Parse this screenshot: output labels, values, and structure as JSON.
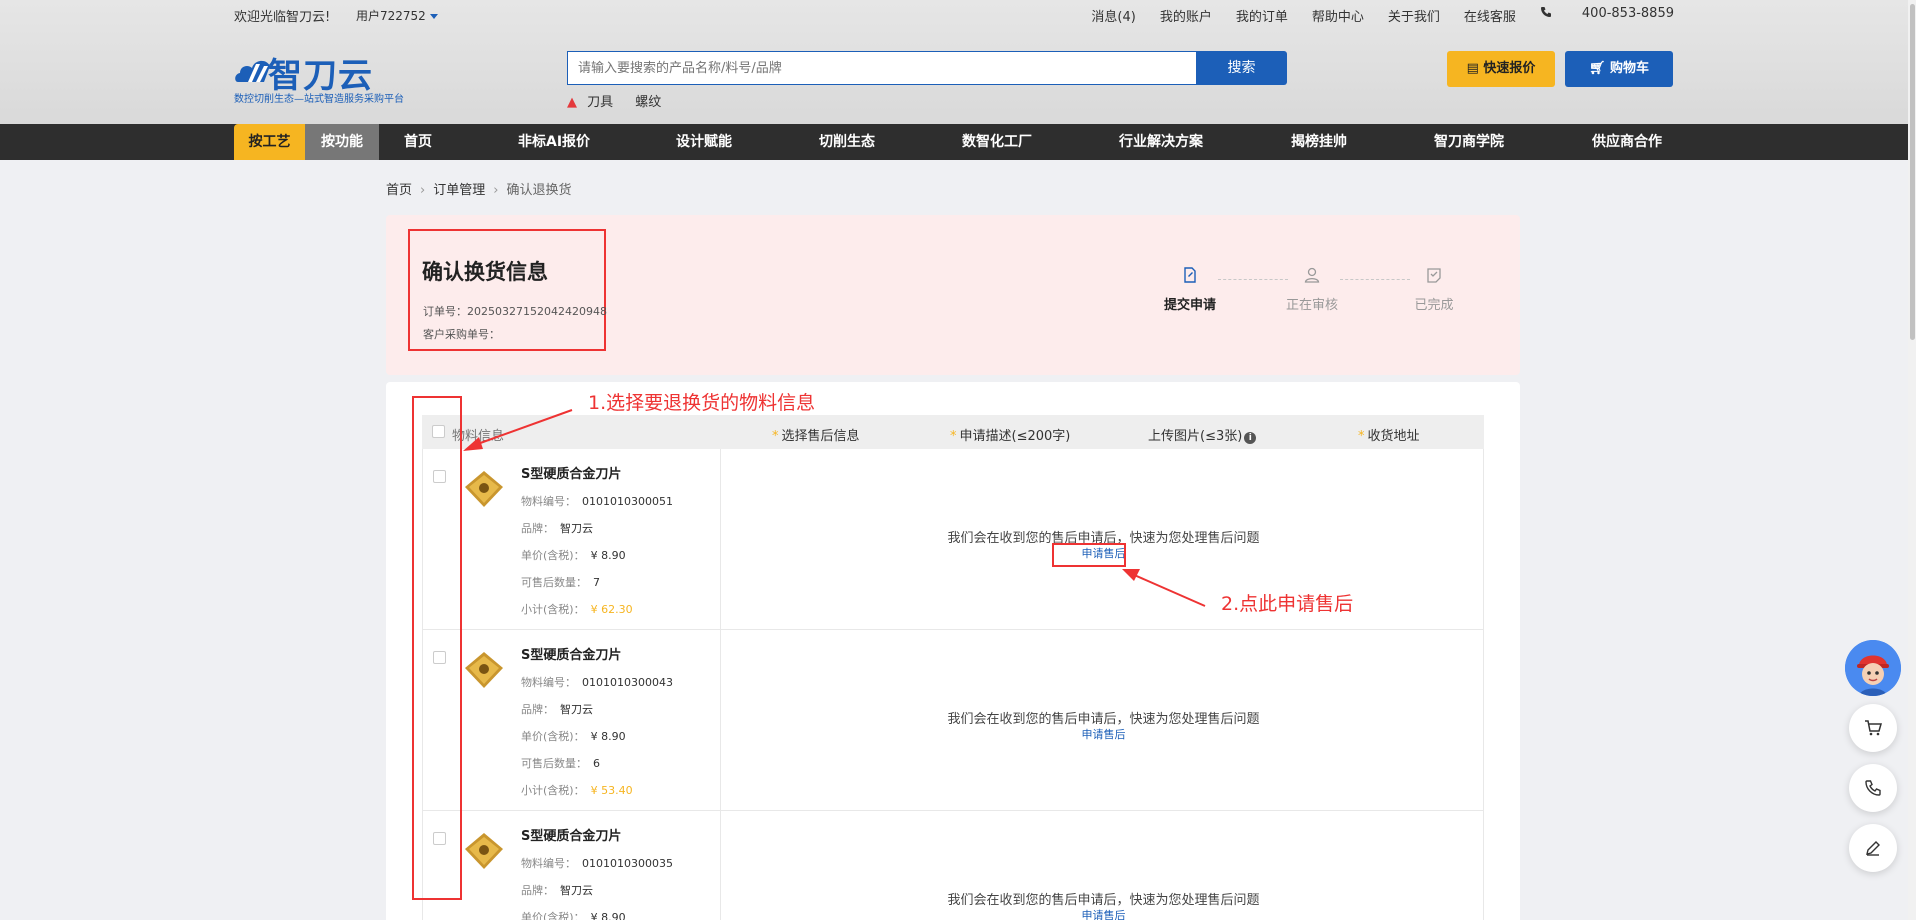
{
  "topbar": {
    "welcome": "欢迎光临智刀云!",
    "user": "用户722752",
    "links": [
      "消息(4)",
      "我的账户",
      "我的订单",
      "帮助中心",
      "关于我们",
      "在线客服"
    ],
    "phone": "400-853-8859"
  },
  "logo": {
    "name": "智刀云",
    "slogan": "数控切削生态—站式智造服务采购平台"
  },
  "search": {
    "placeholder": "请输入要搜索的产品名称/料号/品牌",
    "button": "搜索",
    "hot": [
      "刀具",
      "螺纹"
    ]
  },
  "header_buttons": {
    "quote": "快速报价",
    "cart": "购物车"
  },
  "nav": {
    "tab_process": "按工艺",
    "tab_function": "按功能",
    "items": [
      "首页",
      "非标AI报价",
      "设计赋能",
      "切削生态",
      "数智化工厂",
      "行业解决方案",
      "揭榜挂帅",
      "智刀商学院",
      "供应商合作"
    ]
  },
  "breadcrumb": {
    "home": "首页",
    "orders": "订单管理",
    "current": "确认退换货"
  },
  "info": {
    "title": "确认换货信息",
    "order_no": "订单号：20250327152042420948",
    "po_no": "客户采购单号："
  },
  "steps": [
    "提交申请",
    "正在审核",
    "已完成"
  ],
  "table": {
    "headers": {
      "material": "物料信息",
      "after_sale": "选择售后信息",
      "desc": "申请描述(≤200字)",
      "upload": "上传图片(≤3张)",
      "address": "收货地址"
    },
    "labels": {
      "code": "物料编号：",
      "brand": "品牌：",
      "unit_price": "单价(含税)：",
      "qty": "可售后数量：",
      "subtotal": "小计(含税)："
    },
    "notice": "我们会在收到您的售后申请后，快速为您处理售后问题",
    "apply": "申请售后",
    "rows": [
      {
        "name": "S型硬质合金刀片",
        "code": "0101010300051",
        "brand": "智刀云",
        "unit_price": "¥ 8.90",
        "qty": "7",
        "subtotal": "¥ 62.30"
      },
      {
        "name": "S型硬质合金刀片",
        "code": "0101010300043",
        "brand": "智刀云",
        "unit_price": "¥ 8.90",
        "qty": "6",
        "subtotal": "¥ 53.40"
      },
      {
        "name": "S型硬质合金刀片",
        "code": "0101010300035",
        "brand": "智刀云",
        "unit_price": "¥ 8.90",
        "qty": "",
        "subtotal": ""
      }
    ]
  },
  "annotations": {
    "step1": "1.选择要退换货的物料信息",
    "step2": "2.点此申请售后"
  },
  "colors": {
    "brand_blue": "#1c5fb8",
    "accent_yellow": "#f6b521",
    "annotation_red": "#e33333"
  }
}
